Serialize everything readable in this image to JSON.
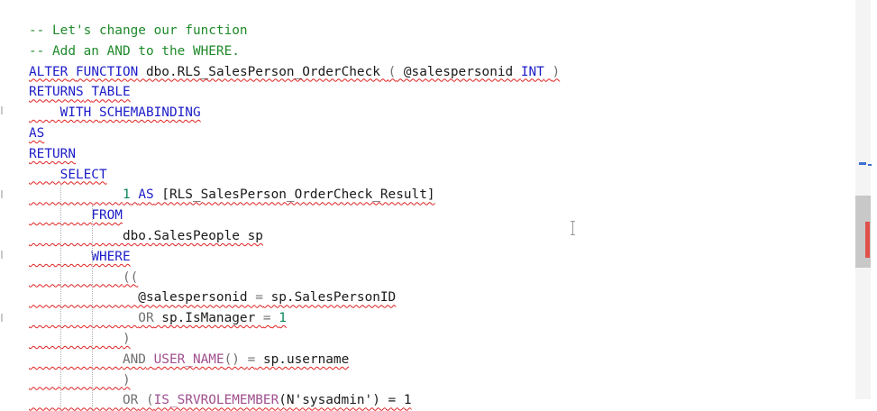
{
  "editor": {
    "lines": [
      {
        "segments": [
          {
            "t": "-- Let's change our function",
            "c": "cm"
          }
        ]
      },
      {
        "segments": [
          {
            "t": "-- Add an AND to the WHERE.",
            "c": "cm"
          }
        ]
      },
      {
        "segments": [
          {
            "t": "ALTER",
            "c": "kw"
          },
          {
            "t": " ",
            "c": "id"
          },
          {
            "t": "FUNCTION",
            "c": "kw"
          },
          {
            "t": " dbo.RLS_SalesPerson_OrderCheck ",
            "c": "id"
          },
          {
            "t": "(",
            "c": "pu"
          },
          {
            "t": " @salespersonid ",
            "c": "id"
          },
          {
            "t": "INT",
            "c": "kw"
          },
          {
            "t": " ",
            "c": "id"
          },
          {
            "t": ")",
            "c": "pu"
          }
        ]
      },
      {
        "segments": [
          {
            "t": "RETURNS",
            "c": "kw"
          },
          {
            "t": " ",
            "c": "id"
          },
          {
            "t": "TABLE",
            "c": "kw"
          }
        ]
      },
      {
        "segments": [
          {
            "t": "    ",
            "c": "id"
          },
          {
            "t": "WITH",
            "c": "kw"
          },
          {
            "t": " ",
            "c": "id"
          },
          {
            "t": "SCHEMABINDING",
            "c": "kw"
          }
        ]
      },
      {
        "segments": [
          {
            "t": "AS",
            "c": "kw"
          }
        ]
      },
      {
        "segments": [
          {
            "t": "RETURN",
            "c": "kw"
          }
        ]
      },
      {
        "segments": [
          {
            "t": "    ",
            "c": "id"
          },
          {
            "t": "SELECT",
            "c": "kw"
          }
        ]
      },
      {
        "segments": [
          {
            "t": "            ",
            "c": "id"
          },
          {
            "t": "1",
            "c": "num"
          },
          {
            "t": " ",
            "c": "id"
          },
          {
            "t": "AS",
            "c": "kw"
          },
          {
            "t": " [RLS_SalesPerson_OrderCheck_Result]",
            "c": "id"
          }
        ]
      },
      {
        "segments": [
          {
            "t": "        ",
            "c": "id"
          },
          {
            "t": "FROM",
            "c": "kw"
          }
        ]
      },
      {
        "segments": [
          {
            "t": "            dbo.SalesPeople sp",
            "c": "id"
          }
        ]
      },
      {
        "segments": [
          {
            "t": "        ",
            "c": "id"
          },
          {
            "t": "WHERE",
            "c": "kw"
          }
        ]
      },
      {
        "segments": [
          {
            "t": "            ",
            "c": "id"
          },
          {
            "t": "((",
            "c": "pu"
          }
        ]
      },
      {
        "segments": [
          {
            "t": "              @salespersonid ",
            "c": "id"
          },
          {
            "t": "=",
            "c": "pu"
          },
          {
            "t": " sp.SalesPersonID",
            "c": "id"
          }
        ]
      },
      {
        "segments": [
          {
            "t": "              ",
            "c": "id"
          },
          {
            "t": "OR",
            "c": "pu"
          },
          {
            "t": " sp.IsManager ",
            "c": "id"
          },
          {
            "t": "=",
            "c": "pu"
          },
          {
            "t": " ",
            "c": "id"
          },
          {
            "t": "1",
            "c": "num"
          }
        ]
      },
      {
        "segments": [
          {
            "t": "            ",
            "c": "id"
          },
          {
            "t": ")",
            "c": "pu"
          }
        ]
      },
      {
        "segments": [
          {
            "t": "            ",
            "c": "id"
          },
          {
            "t": "AND",
            "c": "pu"
          },
          {
            "t": " ",
            "c": "id"
          },
          {
            "t": "USER_NAME",
            "c": "fn"
          },
          {
            "t": "() ",
            "c": "pu"
          },
          {
            "t": "=",
            "c": "pu"
          },
          {
            "t": " sp.username",
            "c": "id"
          }
        ]
      },
      {
        "segments": [
          {
            "t": "            ",
            "c": "id"
          },
          {
            "t": ")",
            "c": "pu"
          }
        ]
      },
      {
        "segments": [
          {
            "t": "            ",
            "c": "id"
          },
          {
            "t": "OR",
            "c": "pu"
          },
          {
            "t": " (",
            "c": "pu"
          },
          {
            "t": "IS_SRVROLEMEMBER",
            "c": "fn"
          },
          {
            "t": "(N'sysadmin') = 1",
            "c": "id"
          }
        ]
      }
    ]
  },
  "colors": {
    "comment": "#1f8a2b",
    "keyword": "#1d1dc8",
    "error_squiggle": "#e02020",
    "scroll_error_marker": "#e0504a"
  }
}
